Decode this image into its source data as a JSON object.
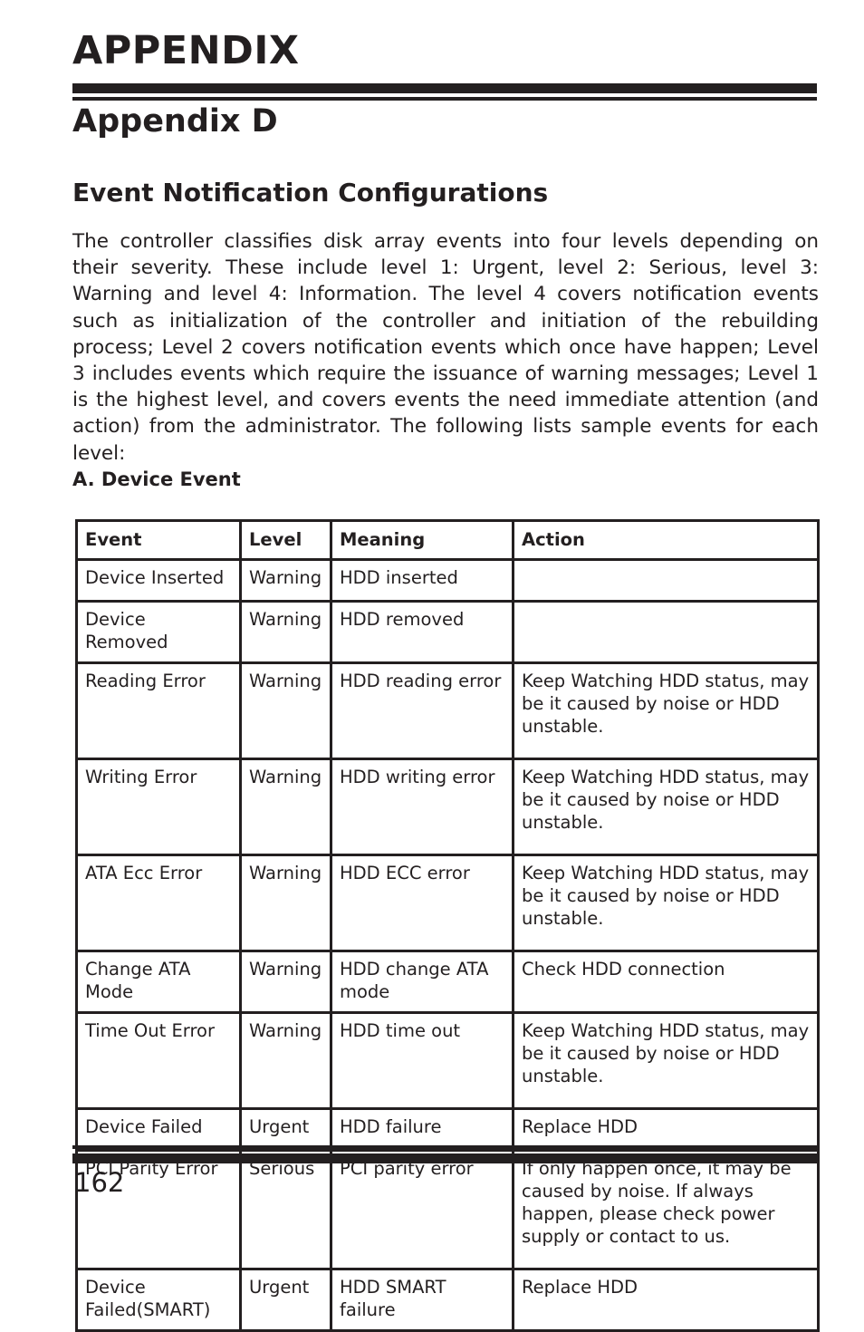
{
  "header": {
    "title": "APPENDIX",
    "subtitle": "Appendix D"
  },
  "section": {
    "heading": "Event Notification Configurations",
    "paragraph": "The controller classifies disk array events into four levels depending on their severity. These include level 1: Urgent, level 2: Serious, level 3: Warning and level 4: Information. The level 4 covers notification events such as initialization of the controller and initiation of the rebuilding process; Level 2 covers notification events which once have happen; Level 3 includes events which require the issuance of warning messages; Level 1 is the highest level, and covers events the need immediate attention (and action) from the administrator. The following lists sample events for each level:"
  },
  "subsection": {
    "heading": "A. Device Event"
  },
  "table": {
    "columns": [
      "Event",
      "Level",
      "Meaning",
      "Action"
    ],
    "rows": [
      {
        "event": "Device Inserted",
        "level": "Warning",
        "meaning": "HDD inserted",
        "action": ""
      },
      {
        "event": "Device Removed",
        "level": "Warning",
        "meaning": "HDD removed",
        "action": ""
      },
      {
        "event": "Reading Error",
        "level": "Warning",
        "meaning": "HDD reading error",
        "action": "Keep Watching HDD status, may be it caused by noise or HDD unstable."
      },
      {
        "event": "Writing Error",
        "level": "Warning",
        "meaning": "HDD writing error",
        "action": "Keep Watching HDD status, may be it caused by noise or HDD unstable."
      },
      {
        "event": "ATA Ecc Error",
        "level": "Warning",
        "meaning": "HDD ECC error",
        "action": "Keep Watching HDD status, may be it caused by noise or HDD unstable."
      },
      {
        "event": "Change ATA Mode",
        "level": "Warning",
        "meaning": "HDD change ATA mode",
        "action": "Check HDD connection"
      },
      {
        "event": "Time Out Error",
        "level": "Warning",
        "meaning": "HDD time out",
        "action": "Keep Watching HDD status, may be it caused by noise or HDD unstable."
      },
      {
        "event": "Device Failed",
        "level": "Urgent",
        "meaning": "HDD failure",
        "action": "Replace HDD"
      },
      {
        "event": "PCI Parity Error",
        "level": "Serious",
        "meaning": "PCI parity error",
        "action": "If only happen once, it may be caused by noise. If always happen, please check power supply or contact to us."
      },
      {
        "event": "Device Failed(SMART)",
        "level": "Urgent",
        "meaning": "HDD SMART failure",
        "action": "Replace HDD"
      }
    ]
  },
  "footer": {
    "page_number": "162"
  },
  "colors": {
    "ink": "#231f20",
    "paper": "#ffffff"
  }
}
